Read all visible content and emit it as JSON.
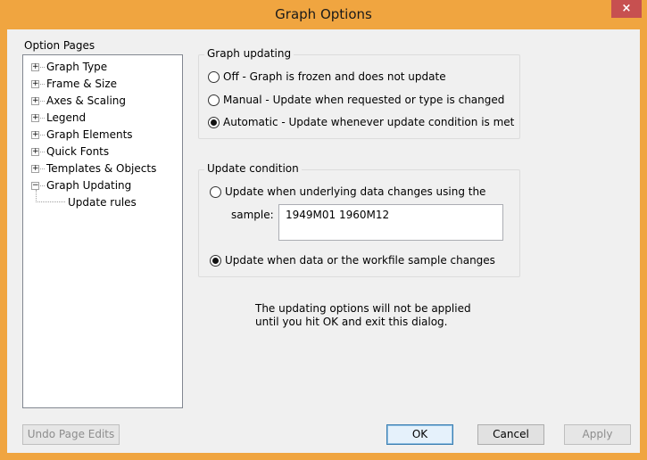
{
  "window": {
    "title": "Graph Options",
    "close_glyph": "×",
    "accent_color": "#f0a540"
  },
  "sidebar": {
    "label": "Option Pages",
    "items": [
      {
        "label": "Graph Type",
        "expander": "+"
      },
      {
        "label": "Frame & Size",
        "expander": "+"
      },
      {
        "label": "Axes & Scaling",
        "expander": "+"
      },
      {
        "label": "Legend",
        "expander": "+"
      },
      {
        "label": "Graph Elements",
        "expander": "+"
      },
      {
        "label": "Quick Fonts",
        "expander": "+"
      },
      {
        "label": "Templates & Objects",
        "expander": "+"
      },
      {
        "label": "Graph Updating",
        "expander": "−"
      }
    ],
    "child": {
      "label": "Update rules"
    }
  },
  "graph_updating": {
    "title": "Graph updating",
    "options": [
      {
        "label": "Off - Graph is frozen and does not update",
        "checked": false
      },
      {
        "label": "Manual - Update when requested or type is changed",
        "checked": false
      },
      {
        "label": "Automatic - Update whenever update condition is met",
        "checked": true
      }
    ]
  },
  "update_condition": {
    "title": "Update condition",
    "option1": {
      "label": "Update when underlying data changes using the",
      "checked": false
    },
    "sample_label": "sample:",
    "sample_value": "1949M01 1960M12",
    "option2": {
      "label": "Update when data or the workfile sample changes",
      "checked": true
    }
  },
  "note": {
    "line1": "The updating options will not be applied",
    "line2": "until you hit OK and exit this dialog."
  },
  "buttons": {
    "undo": "Undo Page Edits",
    "ok": "OK",
    "cancel": "Cancel",
    "apply": "Apply"
  }
}
